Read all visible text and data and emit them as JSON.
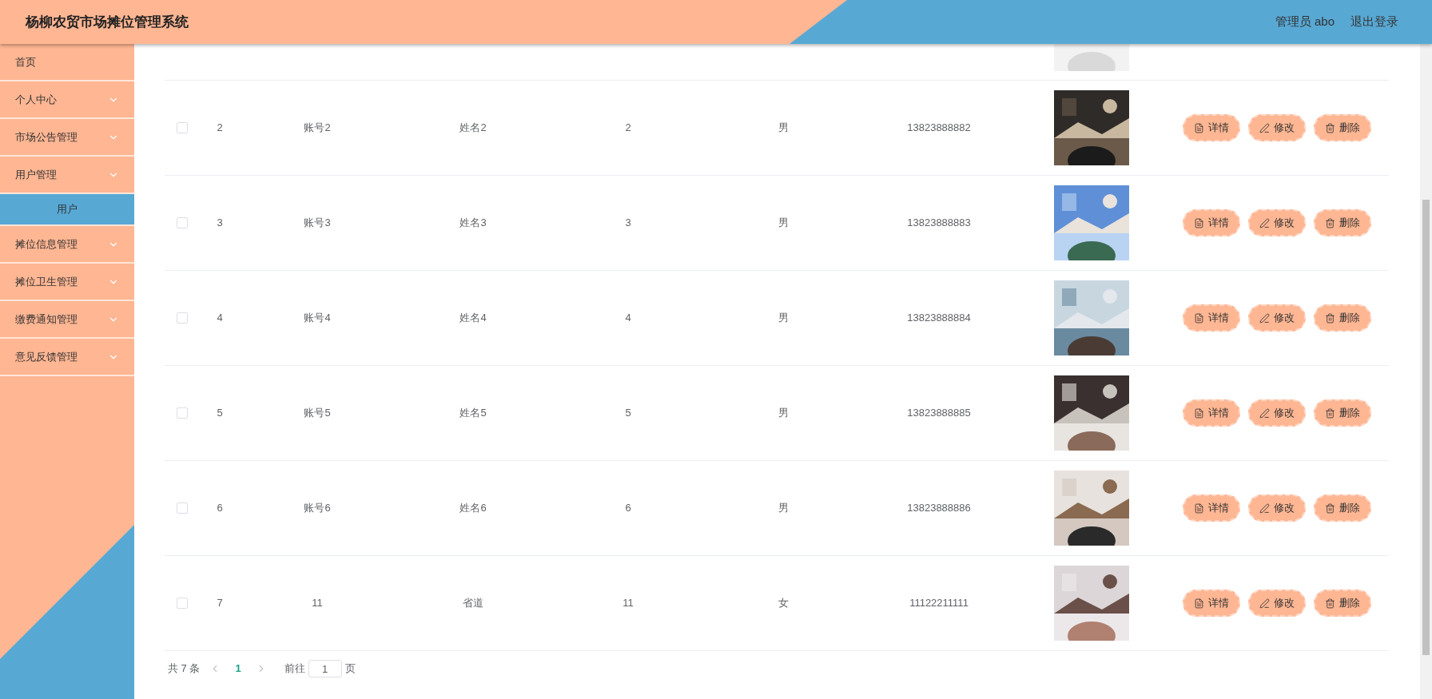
{
  "header": {
    "title": "杨柳农贸市场摊位管理系统",
    "user": "管理员 abo",
    "logout": "退出登录"
  },
  "sidebar": {
    "items": [
      {
        "label": "首页",
        "expandable": false
      },
      {
        "label": "个人中心",
        "expandable": true
      },
      {
        "label": "市场公告管理",
        "expandable": true
      },
      {
        "label": "用户管理",
        "expandable": true,
        "expanded": true,
        "children": [
          {
            "label": "用户",
            "selected": true
          }
        ]
      },
      {
        "label": "摊位信息管理",
        "expandable": true
      },
      {
        "label": "摊位卫生管理",
        "expandable": true
      },
      {
        "label": "缴费通知管理",
        "expandable": true
      },
      {
        "label": "意见反馈管理",
        "expandable": true
      }
    ]
  },
  "table": {
    "rows": [
      {
        "checked": false,
        "index": "2",
        "account": "账号2",
        "name": "姓名2",
        "column_4": "2",
        "gender": "男",
        "phone": "13823888882",
        "actions": [
          {
            "kind": "detail",
            "label": "详情"
          },
          {
            "kind": "edit",
            "label": "修改"
          },
          {
            "kind": "delete",
            "label": "删除"
          }
        ]
      },
      {
        "checked": false,
        "index": "3",
        "account": "账号3",
        "name": "姓名3",
        "column_4": "3",
        "gender": "男",
        "phone": "13823888883",
        "actions": [
          {
            "kind": "detail",
            "label": "详情"
          },
          {
            "kind": "edit",
            "label": "修改"
          },
          {
            "kind": "delete",
            "label": "删除"
          }
        ]
      },
      {
        "checked": false,
        "index": "4",
        "account": "账号4",
        "name": "姓名4",
        "column_4": "4",
        "gender": "男",
        "phone": "13823888884",
        "actions": [
          {
            "kind": "detail",
            "label": "详情"
          },
          {
            "kind": "edit",
            "label": "修改"
          },
          {
            "kind": "delete",
            "label": "删除"
          }
        ]
      },
      {
        "checked": false,
        "index": "5",
        "account": "账号5",
        "name": "姓名5",
        "column_4": "5",
        "gender": "男",
        "phone": "13823888885",
        "actions": [
          {
            "kind": "detail",
            "label": "详情"
          },
          {
            "kind": "edit",
            "label": "修改"
          },
          {
            "kind": "delete",
            "label": "删除"
          }
        ]
      },
      {
        "checked": false,
        "index": "6",
        "account": "账号6",
        "name": "姓名6",
        "column_4": "6",
        "gender": "男",
        "phone": "13823888886",
        "actions": [
          {
            "kind": "detail",
            "label": "详情"
          },
          {
            "kind": "edit",
            "label": "修改"
          },
          {
            "kind": "delete",
            "label": "删除"
          }
        ]
      },
      {
        "checked": false,
        "index": "7",
        "account": "11",
        "name": "省道",
        "column_4": "11",
        "gender": "女",
        "phone": "11122211111",
        "actions": [
          {
            "kind": "detail",
            "label": "详情"
          },
          {
            "kind": "edit",
            "label": "修改"
          },
          {
            "kind": "delete",
            "label": "删除"
          }
        ]
      }
    ]
  },
  "pagination": {
    "total": "共 7 条",
    "pages": [
      {
        "label": "1",
        "selected": true
      }
    ],
    "goto_label": "前往",
    "goto_value": "1",
    "page_suffix": "页"
  }
}
